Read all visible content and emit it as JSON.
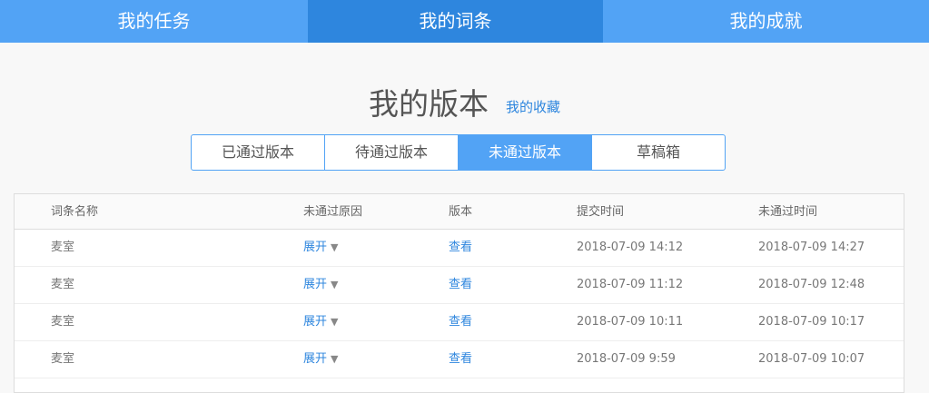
{
  "nav": {
    "tabs": [
      {
        "label": "我的任务"
      },
      {
        "label": "我的词条"
      },
      {
        "label": "我的成就"
      }
    ],
    "active": 1
  },
  "title": "我的版本",
  "favorites_link": "我的收藏",
  "segments": [
    {
      "label": "已通过版本"
    },
    {
      "label": "待通过版本"
    },
    {
      "label": "未通过版本"
    },
    {
      "label": "草稿箱"
    }
  ],
  "table": {
    "headers": [
      "词条名称",
      "未通过原因",
      "版本",
      "提交时间",
      "未通过时间"
    ],
    "rows": [
      {
        "name": "麦室",
        "reason": "展开",
        "arrow": "▼",
        "version": "查看",
        "submitted": "2018-07-09 14:12",
        "rejected": "2018-07-09 14:27"
      },
      {
        "name": "麦室",
        "reason": "展开",
        "arrow": "▼",
        "version": "查看",
        "submitted": "2018-07-09 11:12",
        "rejected": "2018-07-09 12:48"
      },
      {
        "name": "麦室",
        "reason": "展开",
        "arrow": "▼",
        "version": "查看",
        "submitted": "2018-07-09 10:11",
        "rejected": "2018-07-09 10:17"
      },
      {
        "name": "麦室",
        "reason": "展开",
        "arrow": "▼",
        "version": "查看",
        "submitted": "2018-07-09 9:59",
        "rejected": "2018-07-09 10:07"
      }
    ]
  }
}
